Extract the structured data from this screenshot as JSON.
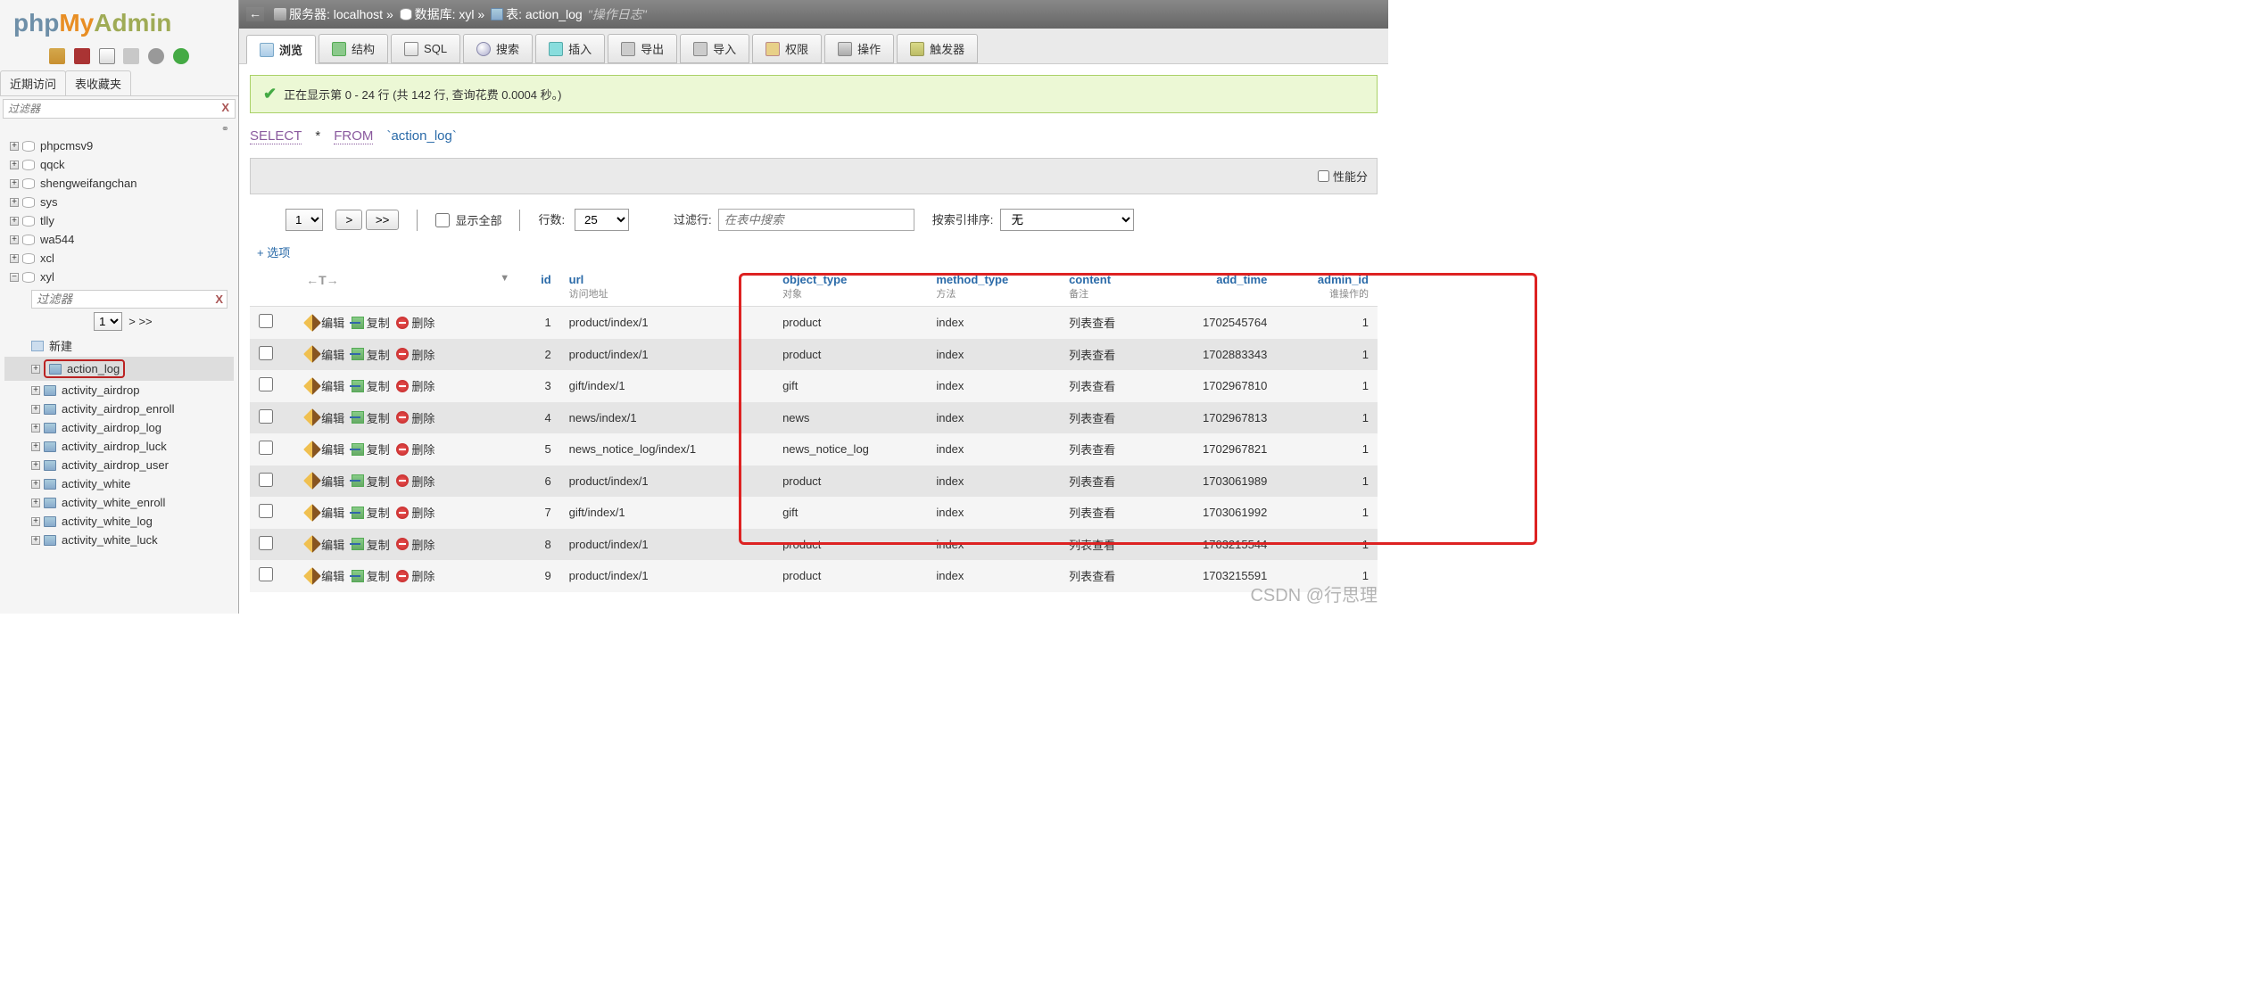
{
  "logo": {
    "p1": "php",
    "p2": "My",
    "p3": "Admin"
  },
  "sidebar_tabs": {
    "recent": "近期访问",
    "favorites": "表收藏夹"
  },
  "filter_placeholder": "过滤器",
  "filter_clear": "X",
  "chain": "⚭",
  "databases": [
    "phpcmsv9",
    "qqck",
    "shengweifangchan",
    "sys",
    "tlly",
    "wa544",
    "xcl",
    "xyl"
  ],
  "expanded_db": "xyl",
  "sub_filter_placeholder": "过滤器",
  "sub_pager": {
    "page": "1",
    "next": ">",
    "last": ">>"
  },
  "new_table": "新建",
  "tables": [
    "action_log",
    "activity_airdrop",
    "activity_airdrop_enroll",
    "activity_airdrop_log",
    "activity_airdrop_luck",
    "activity_airdrop_user",
    "activity_white",
    "activity_white_enroll",
    "activity_white_log",
    "activity_white_luck"
  ],
  "highlighted_table": "action_log",
  "breadcrumb": {
    "back": "←",
    "server_label": "服务器:",
    "server": "localhost",
    "db_label": "数据库:",
    "db": "xyl",
    "table_label": "表:",
    "table": "action_log",
    "comment": "\"操作日志\"",
    "sep": "»"
  },
  "tabs": {
    "browse": "浏览",
    "structure": "结构",
    "sql": "SQL",
    "search": "搜索",
    "insert": "插入",
    "export": "导出",
    "import": "导入",
    "privileges": "权限",
    "operations": "操作",
    "triggers": "触发器"
  },
  "success_msg": "正在显示第 0 - 24 行 (共 142 行, 查询花费 0.0004 秒。)",
  "sql": {
    "select": "SELECT",
    "star": "*",
    "from": "FROM",
    "table": "`action_log`"
  },
  "perf_analysis": "性能分",
  "controls": {
    "page": "1",
    "next": ">",
    "last": ">>",
    "show_all": "显示全部",
    "rows_label": "行数:",
    "rows_value": "25",
    "filter_label": "过滤行:",
    "filter_placeholder": "在表中搜索",
    "sort_label": "按索引排序:",
    "sort_value": "无"
  },
  "options_link": "+ 选项",
  "th_actions": {
    "arrows": "←T→",
    "sort": "▼"
  },
  "columns": [
    {
      "key": "id",
      "label": "id",
      "comment": "",
      "align": "right"
    },
    {
      "key": "url",
      "label": "url",
      "comment": "访问地址",
      "align": "left"
    },
    {
      "key": "object_type",
      "label": "object_type",
      "comment": "对象",
      "align": "left"
    },
    {
      "key": "method_type",
      "label": "method_type",
      "comment": "方法",
      "align": "left"
    },
    {
      "key": "content",
      "label": "content",
      "comment": "备注",
      "align": "left"
    },
    {
      "key": "add_time",
      "label": "add_time",
      "comment": "",
      "align": "right"
    },
    {
      "key": "admin_id",
      "label": "admin_id",
      "comment": "谁操作的",
      "align": "right"
    }
  ],
  "row_actions": {
    "edit": "编辑",
    "copy": "复制",
    "delete": "删除"
  },
  "rows": [
    {
      "id": "1",
      "url": "product/index/1",
      "object_type": "product",
      "method_type": "index",
      "content": "列表查看",
      "add_time": "1702545764",
      "admin_id": "1"
    },
    {
      "id": "2",
      "url": "product/index/1",
      "object_type": "product",
      "method_type": "index",
      "content": "列表查看",
      "add_time": "1702883343",
      "admin_id": "1"
    },
    {
      "id": "3",
      "url": "gift/index/1",
      "object_type": "gift",
      "method_type": "index",
      "content": "列表查看",
      "add_time": "1702967810",
      "admin_id": "1"
    },
    {
      "id": "4",
      "url": "news/index/1",
      "object_type": "news",
      "method_type": "index",
      "content": "列表查看",
      "add_time": "1702967813",
      "admin_id": "1"
    },
    {
      "id": "5",
      "url": "news_notice_log/index/1",
      "object_type": "news_notice_log",
      "method_type": "index",
      "content": "列表查看",
      "add_time": "1702967821",
      "admin_id": "1"
    },
    {
      "id": "6",
      "url": "product/index/1",
      "object_type": "product",
      "method_type": "index",
      "content": "列表查看",
      "add_time": "1703061989",
      "admin_id": "1"
    },
    {
      "id": "7",
      "url": "gift/index/1",
      "object_type": "gift",
      "method_type": "index",
      "content": "列表查看",
      "add_time": "1703061992",
      "admin_id": "1"
    },
    {
      "id": "8",
      "url": "product/index/1",
      "object_type": "product",
      "method_type": "index",
      "content": "列表查看",
      "add_time": "1703215544",
      "admin_id": "1"
    },
    {
      "id": "9",
      "url": "product/index/1",
      "object_type": "product",
      "method_type": "index",
      "content": "列表查看",
      "add_time": "1703215591",
      "admin_id": "1"
    }
  ],
  "watermark": "CSDN @行思理"
}
